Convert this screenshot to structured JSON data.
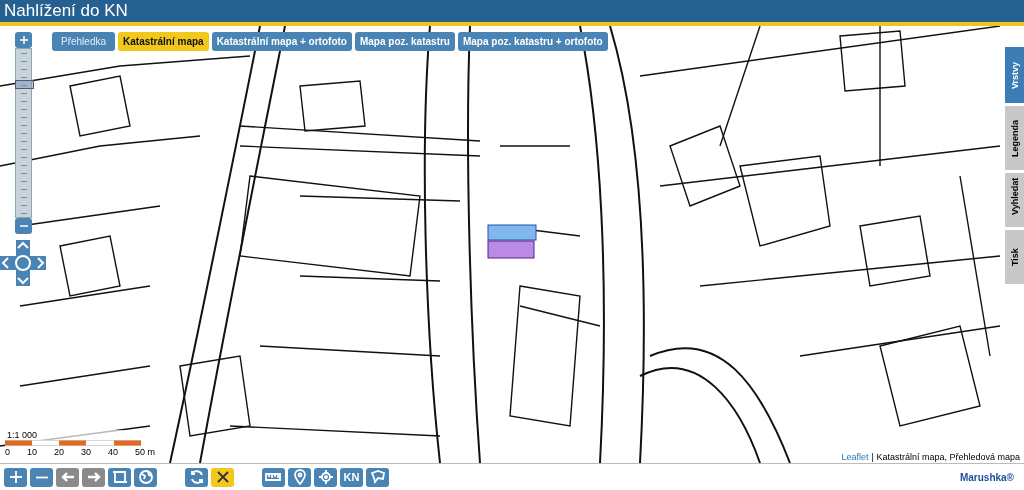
{
  "window": {
    "title": "Nahlížení do KN"
  },
  "map_tabs": [
    {
      "label": "Přehledka",
      "selected": false
    },
    {
      "label": "Katastrální mapa",
      "selected": true
    },
    {
      "label": "Katastrální mapa + ortofoto",
      "selected": false
    },
    {
      "label": "Mapa poz. katastru",
      "selected": false
    },
    {
      "label": "Mapa poz. katastru + ortofoto",
      "selected": false
    }
  ],
  "zoom_slider": {
    "level": 0.76
  },
  "side_tabs": [
    {
      "label": "Vrstvy",
      "selected": true
    },
    {
      "label": "Legenda",
      "selected": false
    },
    {
      "label": "Vyhledat",
      "selected": false
    },
    {
      "label": "Tisk",
      "selected": false
    }
  ],
  "scale": {
    "ratio": "1:1 000",
    "ticks": [
      "0",
      "10",
      "20",
      "30",
      "40",
      "50 m"
    ]
  },
  "attribution": {
    "link": "Leaflet",
    "text": "| Katastrální mapa, Přehledová mapa"
  },
  "toolbar": [
    {
      "kind": "zoom-in",
      "disabled": false,
      "active": false
    },
    {
      "kind": "zoom-out",
      "disabled": false,
      "active": false
    },
    {
      "kind": "back",
      "disabled": true,
      "active": false
    },
    {
      "kind": "forward",
      "disabled": true,
      "active": false
    },
    {
      "kind": "extent",
      "disabled": false,
      "active": false
    },
    {
      "kind": "globe",
      "disabled": false,
      "active": false
    },
    {
      "kind": "refresh",
      "disabled": false,
      "active": false
    },
    {
      "kind": "clear",
      "disabled": false,
      "active": true
    },
    {
      "kind": "measure",
      "disabled": false,
      "active": false
    },
    {
      "kind": "pin",
      "disabled": false,
      "active": false
    },
    {
      "kind": "locate",
      "disabled": false,
      "active": false
    },
    {
      "kind": "text",
      "label": "KN",
      "disabled": false,
      "active": false
    },
    {
      "kind": "shape",
      "disabled": false,
      "active": false
    }
  ],
  "logo": {
    "text": "Marushka®"
  }
}
